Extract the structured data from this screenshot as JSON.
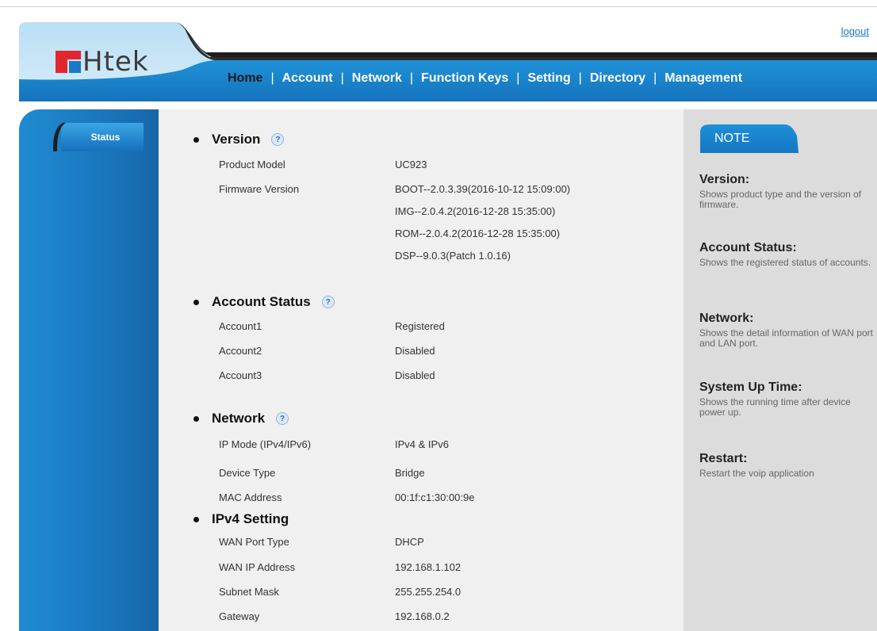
{
  "header": {
    "logout": "logout",
    "logo_text": "Htek",
    "nav": [
      "Home",
      "Account",
      "Network",
      "Function Keys",
      "Setting",
      "Directory",
      "Management"
    ],
    "active_nav": "Home",
    "colors": {
      "brand_blue": "#1a79c4",
      "brand_red": "#e2262d",
      "dark_band": "#1e1e1e"
    }
  },
  "sidebar": {
    "items": [
      {
        "label": "Status"
      }
    ]
  },
  "sections": {
    "version": {
      "title": "Version",
      "rows": [
        {
          "label": "Product Model",
          "value": "UC923"
        },
        {
          "label": "Firmware Version",
          "value": "BOOT--2.0.3.39(2016-10-12 15:09:00)"
        },
        {
          "label": "",
          "value": "IMG--2.0.4.2(2016-12-28 15:35:00)"
        },
        {
          "label": "",
          "value": "ROM--2.0.4.2(2016-12-28 15:35:00)"
        },
        {
          "label": "",
          "value": "DSP--9.0.3(Patch 1.0.16)"
        }
      ]
    },
    "account_status": {
      "title": "Account Status",
      "rows": [
        {
          "label": "Account1",
          "value": "Registered"
        },
        {
          "label": "Account2",
          "value": "Disabled"
        },
        {
          "label": "Account3",
          "value": "Disabled"
        }
      ]
    },
    "network": {
      "title": "Network",
      "rows": [
        {
          "label": "IP Mode (IPv4/IPv6)",
          "value": "IPv4 & IPv6"
        },
        {
          "label": "Device Type",
          "value": "Bridge"
        },
        {
          "label": "MAC Address",
          "value": "00:1f:c1:30:00:9e"
        }
      ]
    },
    "ipv4": {
      "title": "IPv4 Setting",
      "rows": [
        {
          "label": "WAN Port Type",
          "value": "DHCP"
        },
        {
          "label": "WAN IP Address",
          "value": "192.168.1.102"
        },
        {
          "label": "Subnet Mask",
          "value": "255.255.254.0"
        },
        {
          "label": "Gateway",
          "value": "192.168.0.2"
        }
      ]
    }
  },
  "note": {
    "title": "NOTE",
    "items": [
      {
        "heading": "Version:",
        "text": "Shows product type and the version of firmware."
      },
      {
        "heading": "Account Status:",
        "text": "Shows the registered status of accounts."
      },
      {
        "heading": "Network:",
        "text": "Shows the detail information of WAN port and LAN port."
      },
      {
        "heading": "System Up Time:",
        "text": "Shows the running time after device power up."
      },
      {
        "heading": "Restart:",
        "text": "Restart the voip application"
      }
    ]
  }
}
